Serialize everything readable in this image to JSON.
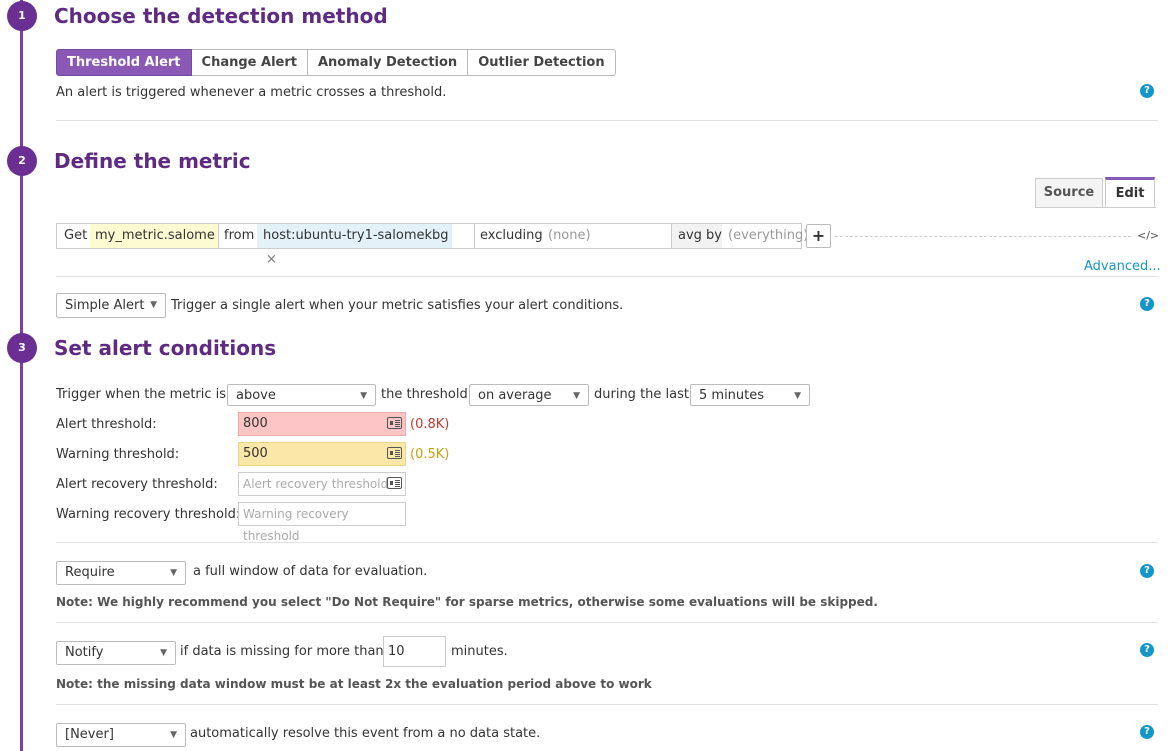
{
  "steps": [
    {
      "number": "1",
      "title": "Choose the detection method"
    },
    {
      "number": "2",
      "title": "Define the metric"
    },
    {
      "number": "3",
      "title": "Set alert conditions"
    }
  ],
  "detection": {
    "tabs": [
      "Threshold Alert",
      "Change Alert",
      "Anomaly Detection",
      "Outlier Detection"
    ],
    "active_tab": "Threshold Alert",
    "description": "An alert is triggered whenever a metric crosses a threshold."
  },
  "metric": {
    "view_tabs": [
      "Source",
      "Edit"
    ],
    "active_view": "Edit",
    "get_label": "Get",
    "metric_name": "my_metric.salome",
    "from_label": "from",
    "host_tag": "host:ubuntu-try1-salomekbg",
    "remove_tag": "×",
    "excluding_label": "excluding",
    "excluding_placeholder": "(none)",
    "avg_by_label": "avg by",
    "avg_by_placeholder": "(everything)",
    "add_button": "+",
    "code_toggle": "</>",
    "advanced_link": "Advanced...",
    "alert_type": "Simple Alert",
    "alert_type_description": "Trigger a single alert when your metric satisfies your alert conditions."
  },
  "conditions": {
    "trigger_prefix": "Trigger when the metric is",
    "comparator": "above",
    "threshold_label": "the threshold",
    "aggregation": "on average",
    "during_label": "during the last",
    "window": "5 minutes",
    "alert_label": "Alert threshold:",
    "alert_value": "800",
    "alert_display": "(0.8K)",
    "warning_label": "Warning threshold:",
    "warning_value": "500",
    "warning_display": "(0.5K)",
    "alert_recovery_label": "Alert recovery threshold:",
    "alert_recovery_placeholder": "Alert recovery threshold",
    "warning_recovery_label": "Warning recovery threshold:",
    "warning_recovery_placeholder": "Warning recovery threshold",
    "require_select": "Require",
    "require_text": "a full window of data for evaluation.",
    "require_note": "Note: We highly recommend you select \"Do Not Require\" for sparse metrics, otherwise some evaluations will be skipped.",
    "notify_select": "Notify",
    "notify_text": "if data is missing for more than",
    "notify_minutes": "10",
    "minutes_label": "minutes.",
    "notify_note": "Note: the missing data window must be at least 2x the evaluation period above to work",
    "resolve_select": "[Never]",
    "resolve_text": "automatically resolve this event from a no data state."
  },
  "help_icon": "?",
  "colors": {
    "accent": "#5e2a82",
    "tab_active": "#8a59b5",
    "alert_bg": "#fcc5c5",
    "warning_bg": "#fbe8a9",
    "alert_text": "#c0392b",
    "warning_text": "#c9a10b",
    "link": "#1496c8"
  }
}
